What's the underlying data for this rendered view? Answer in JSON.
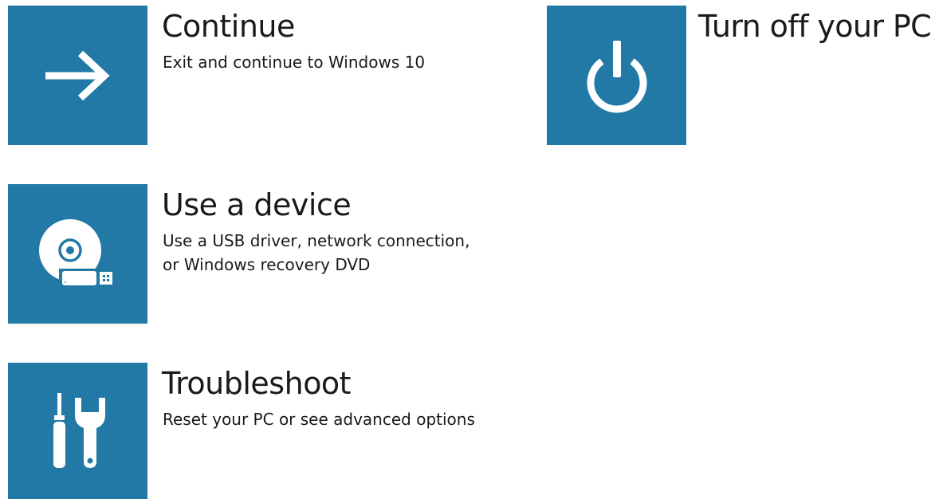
{
  "colors": {
    "tile_background": "#2279a6",
    "icon_foreground": "#ffffff",
    "text": "#1a1a1a",
    "page_background": "#ffffff"
  },
  "options": [
    {
      "id": "continue",
      "icon": "arrow-right-icon",
      "title": "Continue",
      "description": [
        "Exit and continue to Windows 10"
      ]
    },
    {
      "id": "use-device",
      "icon": "disc-usb-icon",
      "title": "Use a device",
      "description": [
        "Use a USB driver, network connection,",
        "or Windows recovery DVD"
      ]
    },
    {
      "id": "troubleshoot",
      "icon": "tools-icon",
      "title": "Troubleshoot",
      "description": [
        "Reset your PC or see advanced options"
      ]
    },
    {
      "id": "turn-off",
      "icon": "power-icon",
      "title": "Turn off your PC",
      "description": []
    }
  ]
}
